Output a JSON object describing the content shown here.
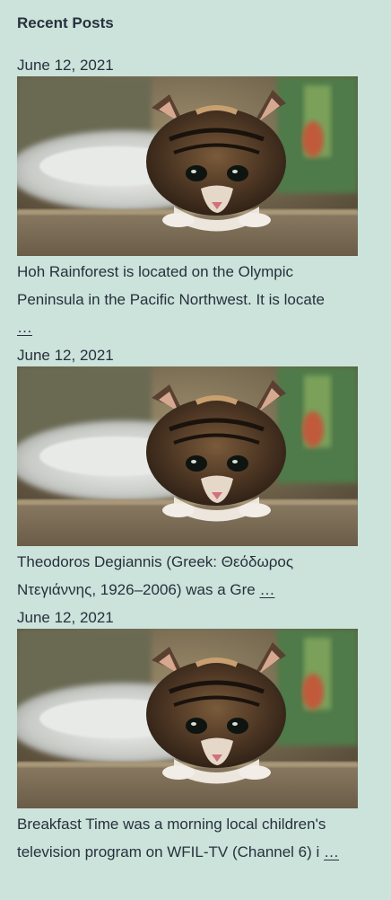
{
  "widget": {
    "title": "Recent Posts"
  },
  "posts": [
    {
      "date": "June 12, 2021",
      "excerpt_line1": "Hoh Rainforest is located on the Olympic",
      "excerpt_line2": "Peninsula in the Pacific Northwest. It is locate",
      "more_label": "…",
      "thumbnail": "kitten-photo"
    },
    {
      "date": "June 12, 2021",
      "excerpt_line1": "Theodoros Degiannis (Greek: Θεόδωρος",
      "excerpt_line2": "Ντεγιάννης, 1926–2006) was a Gre",
      "more_label": "…",
      "thumbnail": "kitten-photo"
    },
    {
      "date": "June 12, 2021",
      "excerpt_line1": "Breakfast Time was a morning local children's",
      "excerpt_line2": "television program on WFIL-TV (Channel 6) i",
      "more_label": "…",
      "thumbnail": "kitten-photo"
    }
  ],
  "colors": {
    "background": "#cbe3da",
    "text": "#28303d"
  }
}
